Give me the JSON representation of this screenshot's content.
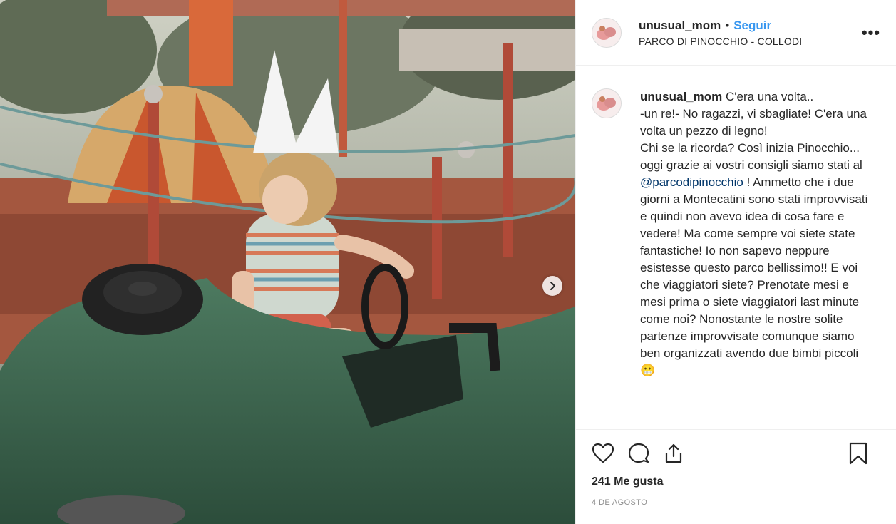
{
  "post": {
    "image_alt": "Child wearing a paper crown sitting in a green toy car on a carousel"
  },
  "header": {
    "username": "unusual_mom",
    "separator": "•",
    "follow_label": "Seguir",
    "location": "PARCO DI PINOCCHIO - COLLODI",
    "more_label": "•••"
  },
  "caption": {
    "username": "unusual_mom",
    "text_before": " C'era una volta..\n-un re!- No ragazzi, vi sbagliate! C'era una volta un pezzo di legno!\nChi se la ricorda? Così inizia Pinocchio... oggi grazie ai vostri consigli siamo stati al ",
    "mention": "@parcodipinocchio",
    "text_after": " ! Ammetto che i due giorni a Montecatini sono stati improvvisati e quindi non avevo idea di cosa fare e vedere! Ma come sempre voi siete state fantastiche! Io non sapevo neppure esistesse questo parco bellissimo!! E voi che viaggiatori siete? Prenotate mesi e mesi prima o siete viaggiatori last minute come noi? Nonostante le nostre solite partenze improvvisate comunque siamo ben organizzati avendo due bimbi piccoli ",
    "emoji": "😬"
  },
  "actions": {
    "like_icon": "heart-icon",
    "comment_icon": "comment-icon",
    "share_icon": "share-icon",
    "save_icon": "bookmark-icon"
  },
  "likes": "241 Me gusta",
  "date": "4 DE AGOSTO",
  "colors": {
    "link": "#3897f0",
    "mention": "#003569",
    "meta": "#8e8e8e"
  }
}
